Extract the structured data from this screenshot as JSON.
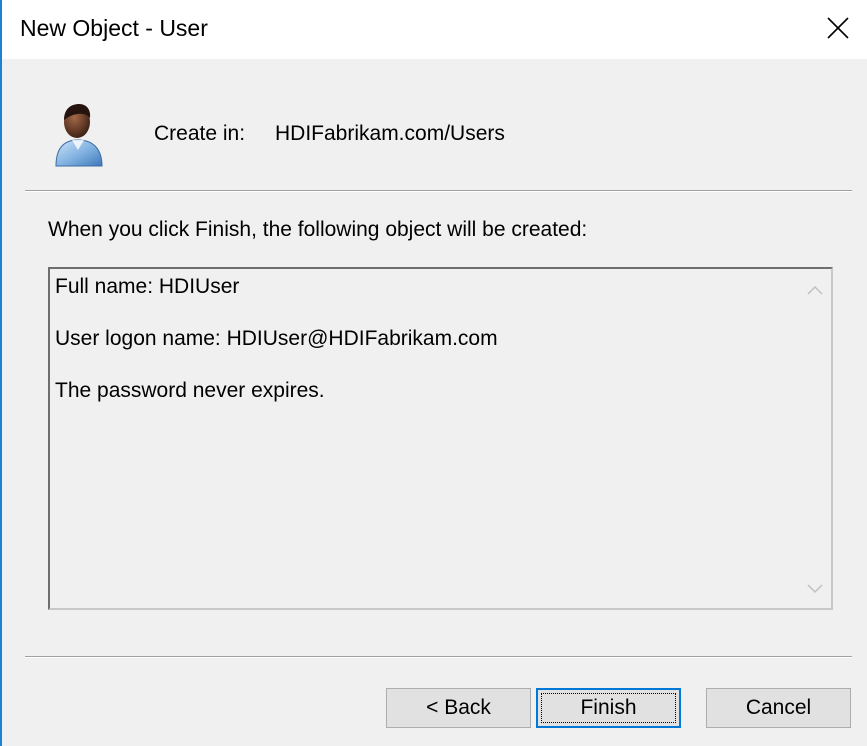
{
  "window": {
    "title": "New Object - User"
  },
  "header": {
    "icon": "user-icon",
    "create_in_label": "Create in:",
    "create_in_value": "HDIFabrikam.com/Users"
  },
  "summary": {
    "intro": "When you click Finish, the following object will be created:",
    "lines": [
      "Full name: HDIUser",
      "User logon name: HDIUser@HDIFabrikam.com",
      "The password never expires."
    ]
  },
  "buttons": {
    "back": "< Back",
    "finish": "Finish",
    "cancel": "Cancel"
  },
  "colors": {
    "accent": "#0078d7",
    "window_border": "#1883d7",
    "dialog_bg": "#f0f0f0"
  }
}
